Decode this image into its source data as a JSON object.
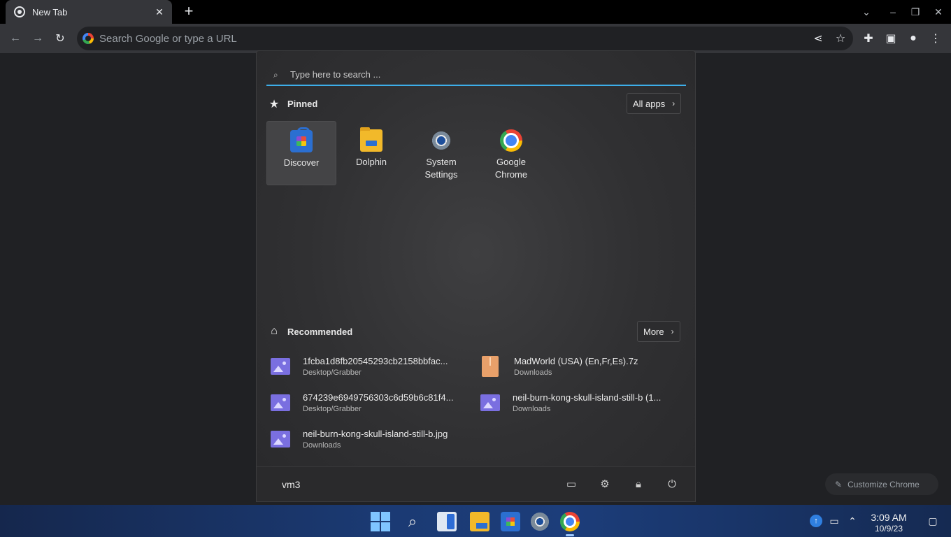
{
  "browser": {
    "tab_title": "New Tab",
    "tab_close": "✕",
    "new_tab": "+",
    "omnibox_placeholder": "Search Google or type a URL",
    "customize_label": "Customize Chrome"
  },
  "start_menu": {
    "search_placeholder": "Type here to search ...",
    "pinned_title": "Pinned",
    "all_apps_label": "All apps",
    "pinned_apps": [
      {
        "label": "Discover",
        "icon": "discover-icon"
      },
      {
        "label": "Dolphin",
        "icon": "folder-icon"
      },
      {
        "label": "System Settings",
        "icon": "settings-icon"
      },
      {
        "label": "Google Chrome",
        "icon": "chrome-icon"
      }
    ],
    "recommended_title": "Recommended",
    "more_label": "More",
    "recommended": [
      {
        "name": "1fcba1d8fb20545293cb2158bbfac...",
        "path": "Desktop/Grabber",
        "icon": "image-file-icon"
      },
      {
        "name": "MadWorld (USA) (En,Fr,Es).7z",
        "path": "Downloads",
        "icon": "archive-icon"
      },
      {
        "name": "674239e6949756303c6d59b6c81f4...",
        "path": "Desktop/Grabber",
        "icon": "image-file-icon"
      },
      {
        "name": "neil-burn-kong-skull-island-still-b (1...",
        "path": "Downloads",
        "icon": "image-file-icon"
      },
      {
        "name": "neil-burn-kong-skull-island-still-b.jpg",
        "path": "Downloads",
        "icon": "image-file-icon"
      }
    ],
    "user_name": "vm3"
  },
  "taskbar": {
    "clock_time": "3:09 AM",
    "clock_date": "10/9/23"
  },
  "colors": {
    "accent": "#3daee9",
    "taskbar": "#1b3a73",
    "menu_bg": "#303032"
  }
}
